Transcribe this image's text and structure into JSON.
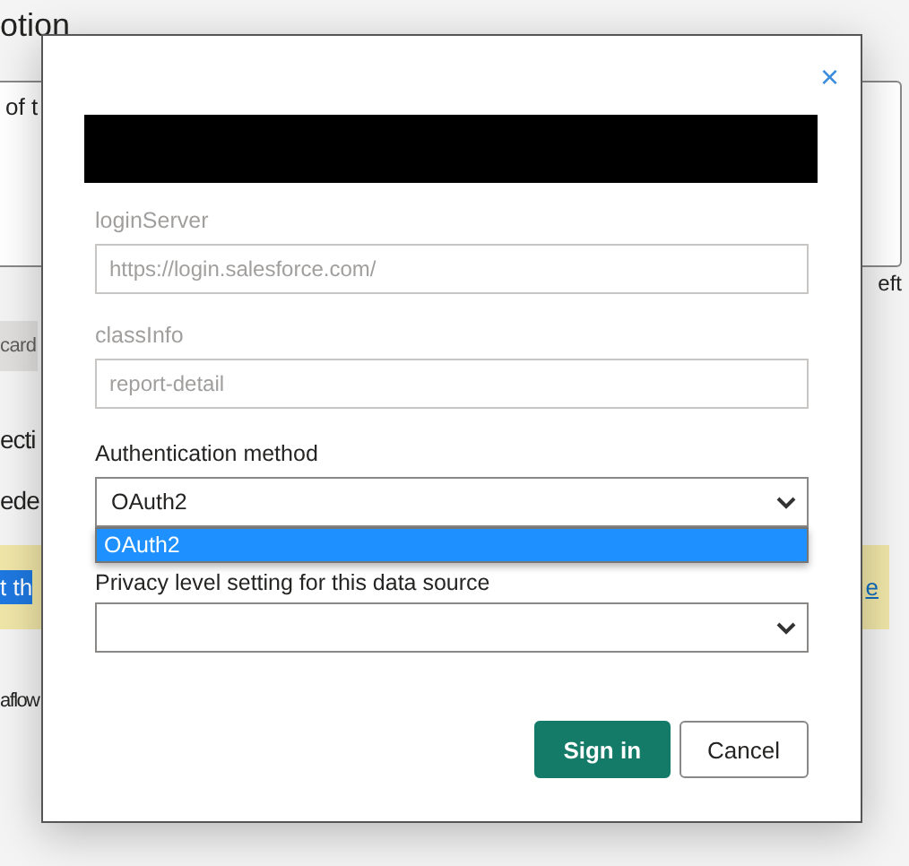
{
  "background_page": {
    "heading": "otion",
    "description_box": {
      "text": "of t"
    },
    "side_text": "eft",
    "chip": "card",
    "section_title": "ecti",
    "subsection_title": "ede",
    "banner": {
      "selected_text": "t th",
      "link": "e"
    },
    "footer_text": "aflow"
  },
  "dialog": {
    "close": "×",
    "redacted": true,
    "fields": [
      {
        "label": "loginServer",
        "value": "https://login.salesforce.com/",
        "disabled": true
      },
      {
        "label": "classInfo",
        "value": "report-detail",
        "disabled": true
      }
    ],
    "auth_method": {
      "label": "Authentication method",
      "value": "OAuth2",
      "expanded": true,
      "options": [
        {
          "label": "OAuth2",
          "selected": true
        }
      ]
    },
    "privacy_level": {
      "label": "Privacy level setting for this data source"
    },
    "buttons": [
      {
        "label": "Sign in",
        "kind": "primary"
      },
      {
        "label": "Cancel",
        "kind": "secondary"
      }
    ]
  }
}
